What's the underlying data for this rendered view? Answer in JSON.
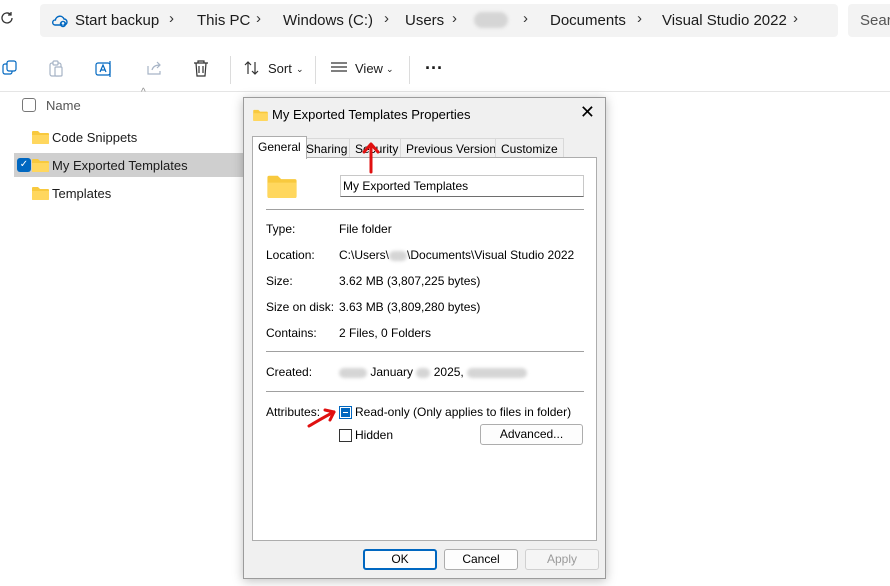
{
  "address_bar": {
    "start_backup": "Start backup",
    "crumbs": [
      "This PC",
      "Windows (C:)",
      "Users",
      "Documents",
      "Visual Studio 2022"
    ],
    "search_placeholder": "Searc"
  },
  "toolbar": {
    "sort_label": "Sort",
    "view_label": "View",
    "more_label": "···"
  },
  "file_list": {
    "column_name": "Name",
    "items": [
      {
        "label": "Code Snippets",
        "selected": false
      },
      {
        "label": "My Exported Templates",
        "selected": true
      },
      {
        "label": "Templates",
        "selected": false
      }
    ]
  },
  "dialog": {
    "title": "My Exported Templates Properties",
    "tabs": [
      "General",
      "Sharing",
      "Security",
      "Previous Versions",
      "Customize"
    ],
    "active_tab": "General",
    "folder_name": "My Exported Templates",
    "type_label": "Type:",
    "type_value": "File folder",
    "location_label": "Location:",
    "location_value_prefix": "C:\\Users\\",
    "location_value_suffix": "\\Documents\\Visual Studio 2022",
    "size_label": "Size:",
    "size_value": "3.62 MB (3,807,225 bytes)",
    "size_on_disk_label": "Size on disk:",
    "size_on_disk_value": "3.63 MB (3,809,280 bytes)",
    "contains_label": "Contains:",
    "contains_value": "2 Files, 0 Folders",
    "created_label": "Created:",
    "created_month": "January",
    "created_year": "2025,",
    "attributes_label": "Attributes:",
    "readonly_label": "Read-only (Only applies to files in folder)",
    "hidden_label": "Hidden",
    "advanced_button": "Advanced...",
    "ok_button": "OK",
    "cancel_button": "Cancel",
    "apply_button": "Apply"
  },
  "colors": {
    "accent": "#0067c0",
    "annotation_red": "#e01010",
    "folder_yellow": "#f8c93e"
  }
}
